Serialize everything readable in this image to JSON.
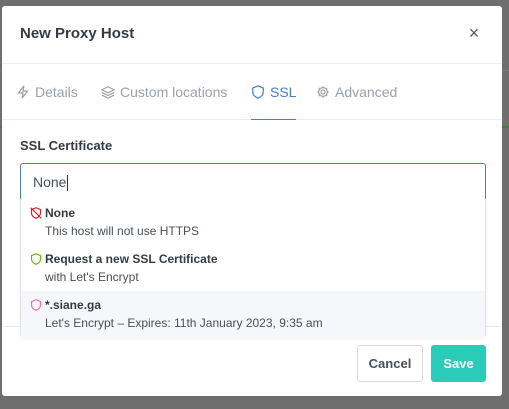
{
  "modal": {
    "title": "New Proxy Host",
    "close_label": "×"
  },
  "tabs": [
    {
      "label": "Details",
      "icon": "lightning-icon",
      "active": false
    },
    {
      "label": "Custom locations",
      "icon": "layers-icon",
      "active": false
    },
    {
      "label": "SSL",
      "icon": "shield-icon",
      "active": true
    },
    {
      "label": "Advanced",
      "icon": "gear-icon",
      "active": false
    }
  ],
  "ssl": {
    "field_label": "SSL Certificate",
    "value": "None"
  },
  "dropdown": {
    "options": [
      {
        "title": "None",
        "subtitle": "This host will not use HTTPS",
        "icon": "shield-off-icon",
        "icon_color": "#cd201f"
      },
      {
        "title": "Request a new SSL Certificate",
        "subtitle": "with Let's Encrypt",
        "icon": "shield-icon",
        "icon_color": "#5eba00"
      },
      {
        "title": "*.siane.ga",
        "subtitle": "Let's Encrypt – Expires: 11th January 2023, 9:35 am",
        "icon": "shield-icon",
        "icon_color": "#f66d9b"
      }
    ]
  },
  "footer": {
    "cancel_label": "Cancel",
    "save_label": "Save"
  },
  "colors": {
    "accent": "#467fcf",
    "save": "#2bcbba",
    "backdrop": "#6e6e6e"
  }
}
